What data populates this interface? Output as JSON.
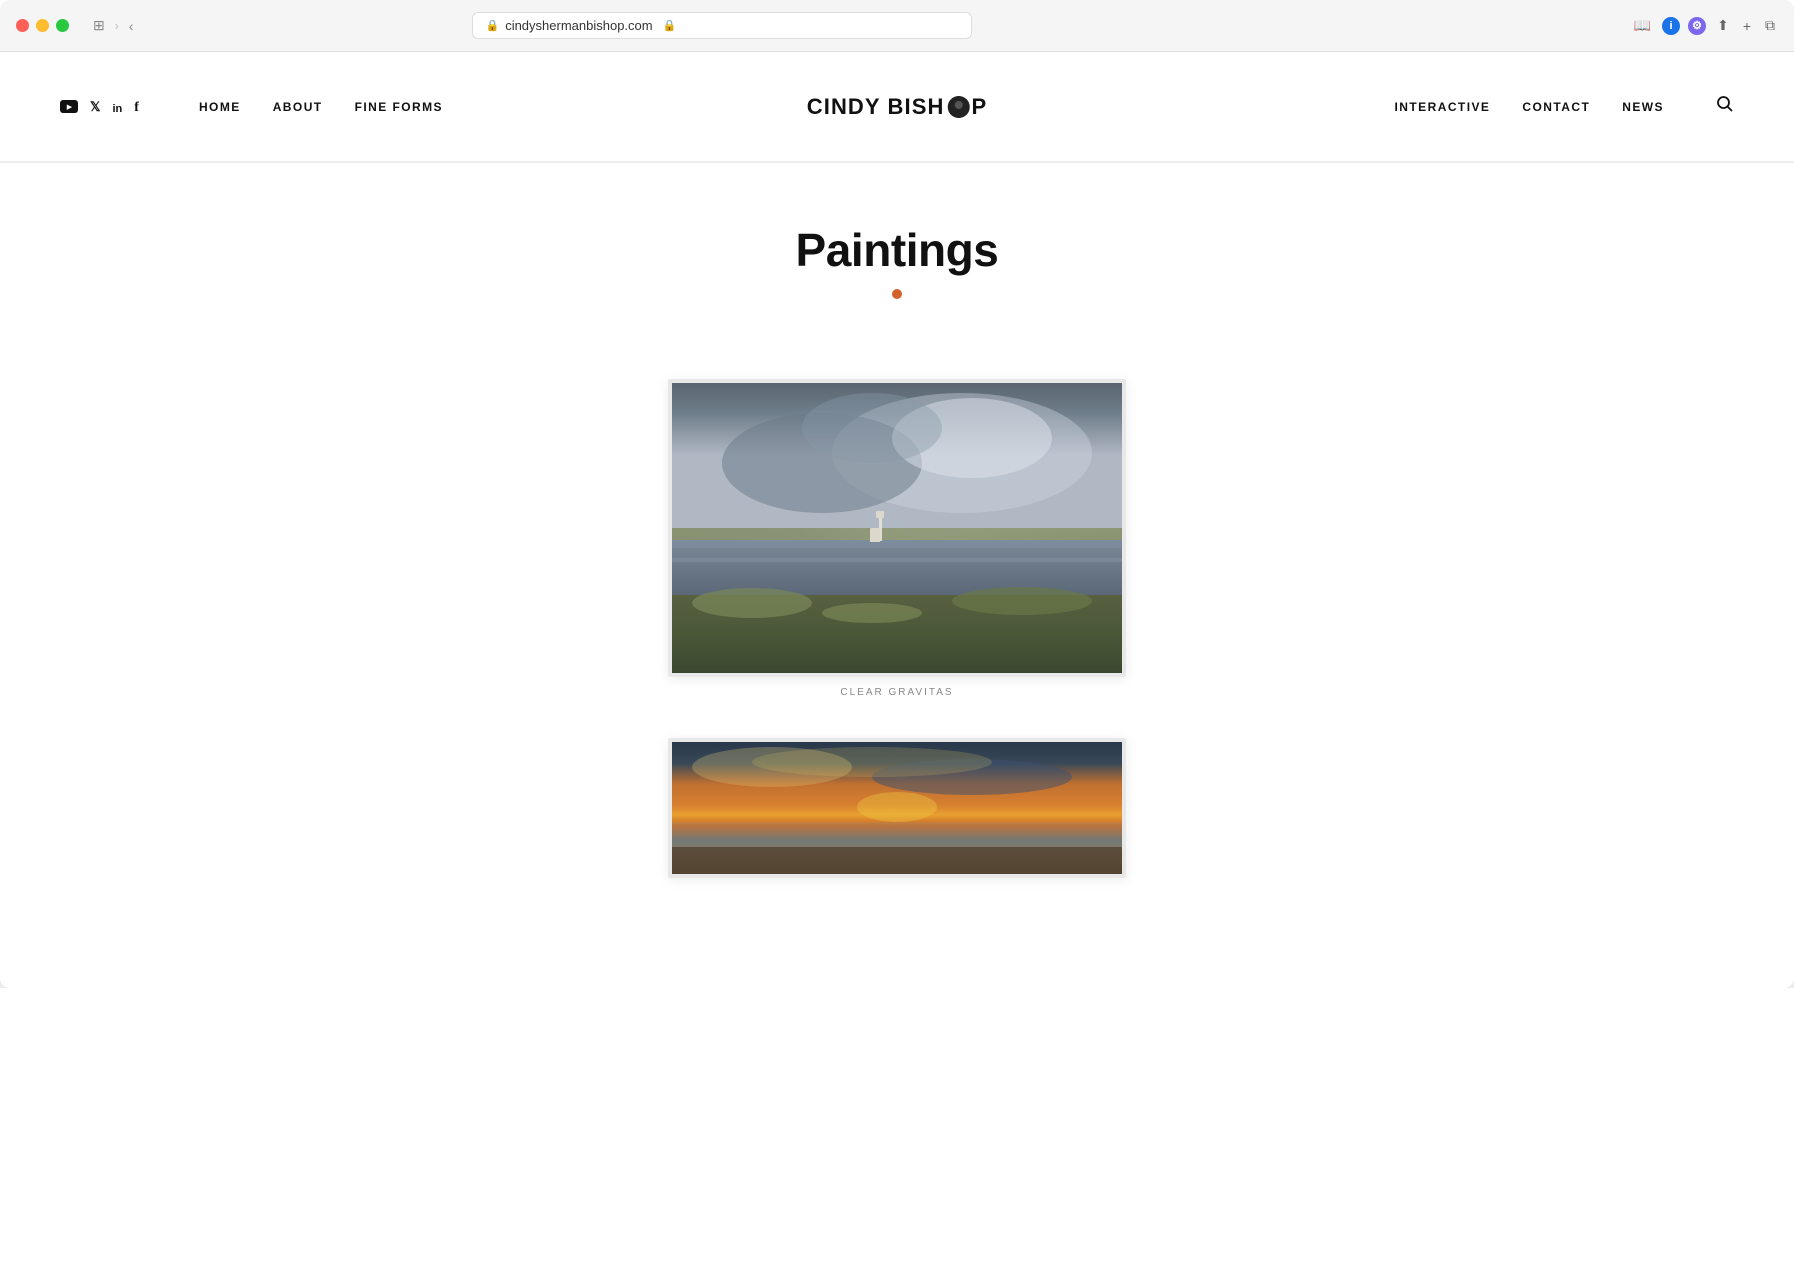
{
  "browser": {
    "url": "cindyshermanbishop.com",
    "secure": true,
    "dots": [
      "red",
      "yellow",
      "green"
    ]
  },
  "nav": {
    "social": {
      "youtube_label": "YouTube",
      "twitter_label": "Twitter",
      "linkedin_label": "LinkedIn",
      "facebook_label": "Facebook"
    },
    "left_links": [
      {
        "label": "HOME",
        "href": "#"
      },
      {
        "label": "ABOUT",
        "href": "#"
      },
      {
        "label": "FINE FORMS",
        "href": "#"
      }
    ],
    "logo": "CINDY BISH●P",
    "logo_text_1": "CINDY BISH",
    "logo_text_2": "P",
    "right_links": [
      {
        "label": "INTERACTIVE",
        "href": "#"
      },
      {
        "label": "CONTACT",
        "href": "#"
      },
      {
        "label": "NEWS",
        "href": "#"
      }
    ]
  },
  "page": {
    "title": "Paintings",
    "accent_color": "#d2622a"
  },
  "paintings": [
    {
      "id": 1,
      "caption": "CLEAR GRAVITAS",
      "alt": "Stormy landscape with lighthouse painting"
    },
    {
      "id": 2,
      "caption": "",
      "alt": "Sunset seascape painting"
    }
  ]
}
